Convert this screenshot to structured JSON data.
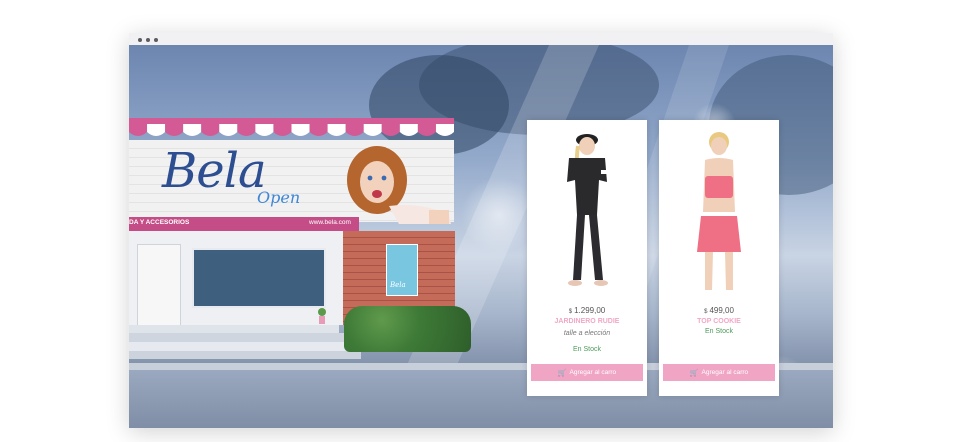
{
  "browser": {
    "window_dots": 3
  },
  "store": {
    "brand": "Bela",
    "brand_sub": "Open",
    "sign_left": "DA Y ACCESORIOS",
    "sign_right": "www.bela.com",
    "poster_brand": "Bela"
  },
  "products": [
    {
      "currency": "$",
      "price": "1.299,00",
      "name": "JARDINERO RUDIE",
      "option": "talle a elección",
      "stock": "En Stock",
      "button": "Agregar al carro",
      "cart_icon": "cart-icon"
    },
    {
      "currency": "$",
      "price": "499,00",
      "name": "TOP COOKIE",
      "stock": "En Stock",
      "button": "Agregar al carro",
      "cart_icon": "cart-icon"
    }
  ],
  "colors": {
    "accent_pink": "#f0a5c5",
    "brand_blue": "#2d4f91",
    "sign_magenta": "#c44d87",
    "stock_green": "#4c9a5a"
  }
}
